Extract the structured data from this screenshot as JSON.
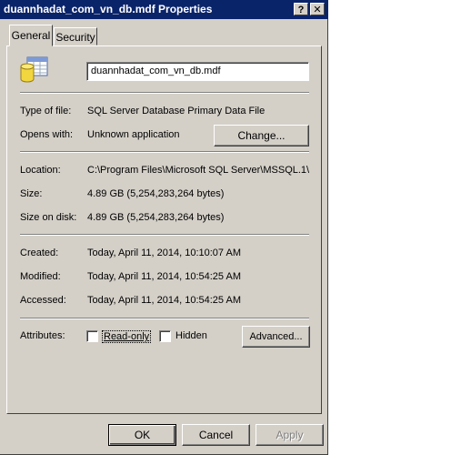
{
  "window": {
    "title": "duannhadat_com_vn_db.mdf Properties",
    "help_button": "?",
    "close_button": "✕"
  },
  "tabs": [
    {
      "label": "General",
      "active": true
    },
    {
      "label": "Security",
      "active": false
    }
  ],
  "file": {
    "icon": "database-file-icon",
    "name": "duannhadat_com_vn_db.mdf"
  },
  "details": {
    "type_label": "Type of file:",
    "type_value": "SQL Server Database Primary Data File",
    "opens_label": "Opens with:",
    "opens_value": "Unknown application",
    "change_button": "Change...",
    "location_label": "Location:",
    "location_value": "C:\\Program Files\\Microsoft SQL Server\\MSSQL.1\\",
    "size_label": "Size:",
    "size_value": "4.89 GB (5,254,283,264 bytes)",
    "size_on_disk_label": "Size on disk:",
    "size_on_disk_value": "4.89 GB (5,254,283,264 bytes)",
    "created_label": "Created:",
    "created_value": "Today, April 11, 2014, 10:10:07 AM",
    "modified_label": "Modified:",
    "modified_value": "Today, April 11, 2014, 10:54:25 AM",
    "accessed_label": "Accessed:",
    "accessed_value": "Today, April 11, 2014, 10:54:25 AM"
  },
  "attributes": {
    "label": "Attributes:",
    "readonly_label": "Read-only",
    "readonly_checked": false,
    "hidden_label": "Hidden",
    "hidden_checked": false,
    "advanced_button": "Advanced..."
  },
  "footer": {
    "ok": "OK",
    "cancel": "Cancel",
    "apply": "Apply"
  },
  "colors": {
    "titlebar": "#0a246a",
    "face": "#d4d0c8"
  }
}
